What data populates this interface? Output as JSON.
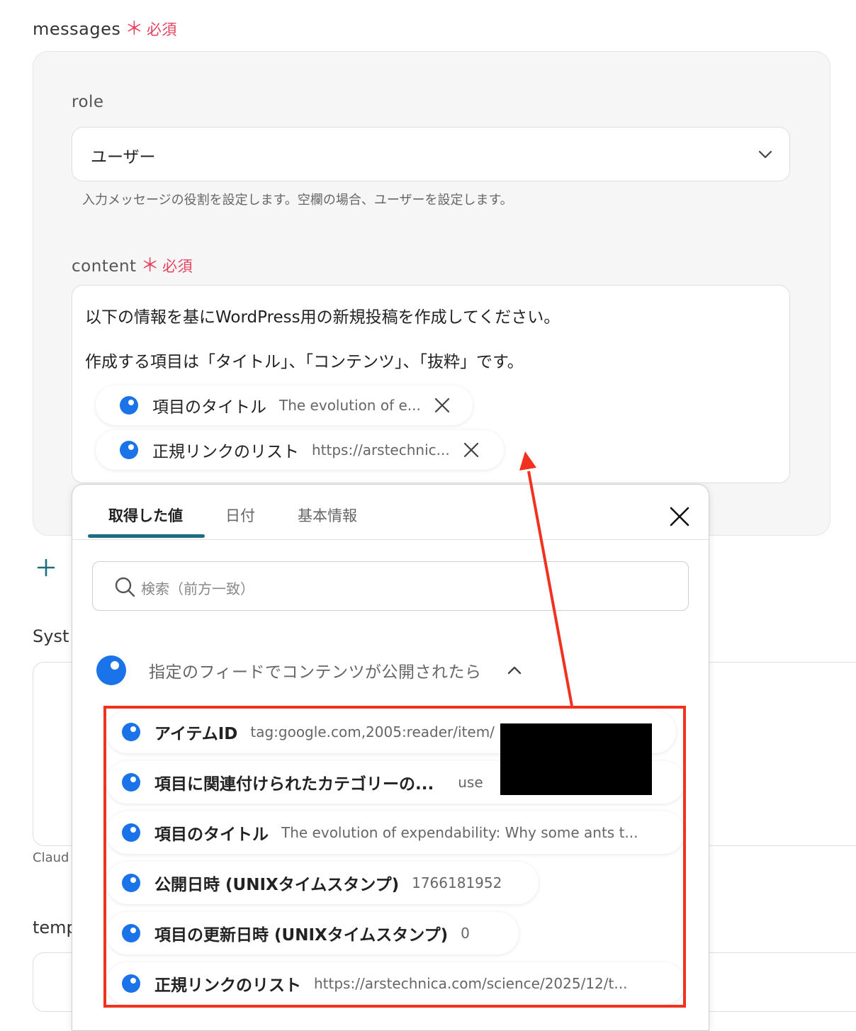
{
  "messages": {
    "label": "messages",
    "required_star": "＊",
    "required_text": "必須"
  },
  "role": {
    "label": "role",
    "value": "ユーザー",
    "help": "入力メッセージの役割を設定します。空欄の場合、ユーザーを設定します。"
  },
  "content": {
    "label": "content",
    "required_star": "＊",
    "required_text": "必須",
    "line1": "以下の情報を基にWordPress用の新規投稿を作成してください。",
    "line2": "作成する項目は「タイトル」、「コンテンツ」、「抜粋」です。",
    "chips": [
      {
        "label": "項目のタイトル",
        "value": "The evolution of e..."
      },
      {
        "label": "正規リンクのリスト",
        "value": "https://arstechnic..."
      }
    ]
  },
  "system_label": "Syst",
  "claude_help": "Claud",
  "temp_label": "temp",
  "popover": {
    "tabs": [
      "取得した値",
      "日付",
      "基本情報"
    ],
    "search_placeholder": "検索（前方一致）",
    "group_title": "指定のフィードでコンテンツが公開されたら",
    "items": [
      {
        "label": "アイテムID",
        "value": "tag:google.com,2005:reader/item/"
      },
      {
        "label": "項目に関連付けられたカテゴリーの...",
        "value": "use"
      },
      {
        "label": "項目のタイトル",
        "value": "The evolution of expendability: Why some ants t..."
      },
      {
        "label": "公開日時 (UNIXタイムスタンプ)",
        "value": "1766181952"
      },
      {
        "label": "項目の更新日時 (UNIXタイムスタンプ)",
        "value": "0"
      },
      {
        "label": "正規リンクのリスト",
        "value": "https://arstechnica.com/science/2025/12/t..."
      }
    ]
  },
  "colors": {
    "accent": "#1a73e8",
    "required": "#e4425f",
    "tab_underline": "#1f6e80",
    "annotation": "#f0321e"
  }
}
